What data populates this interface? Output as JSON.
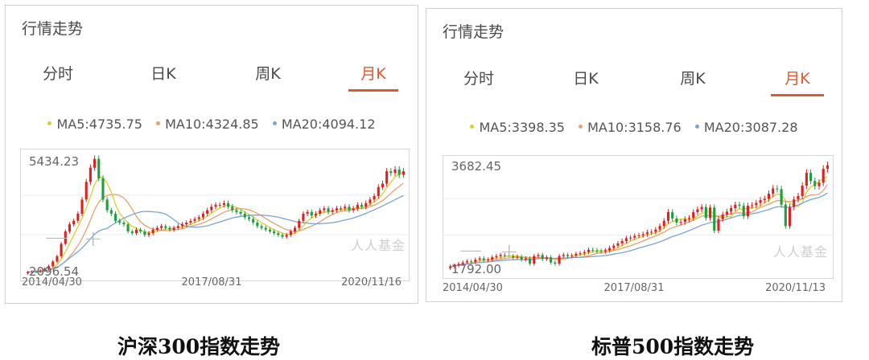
{
  "panels": [
    {
      "title": "行情走势",
      "tabs": [
        "分时",
        "日K",
        "周K",
        "月K"
      ],
      "active_tab": 3,
      "legend": [
        {
          "label": "MA5:4735.75",
          "color": "#d4d429"
        },
        {
          "label": "MA10:4324.85",
          "color": "#e8a070"
        },
        {
          "label": "MA20:4094.12",
          "color": "#7ba4d6"
        }
      ],
      "y_max_label": "5434.23",
      "y_min_label": "2096.54",
      "x_labels": [
        "2014/04/30",
        "2017/08/31",
        "2020/11/16"
      ],
      "watermark": "人人基金",
      "zoom_out": "—",
      "zoom_in": "+"
    },
    {
      "title": "行情走势",
      "tabs": [
        "分时",
        "日K",
        "周K",
        "月K"
      ],
      "active_tab": 3,
      "legend": [
        {
          "label": "MA5:3398.35",
          "color": "#d4d429"
        },
        {
          "label": "MA10:3158.76",
          "color": "#e8a070"
        },
        {
          "label": "MA20:3087.28",
          "color": "#7ba4d6"
        }
      ],
      "y_max_label": "3682.45",
      "y_min_label": "1792.00",
      "x_labels": [
        "2014/04/30",
        "2017/08/31",
        "2020/11/13"
      ],
      "watermark": "人人基金",
      "zoom_out": "—",
      "zoom_in": "+"
    }
  ],
  "captions": [
    "沪深300指数走势",
    "标普500指数走势"
  ],
  "chart_data": [
    {
      "type": "candlestick",
      "title": "沪深300指数走势",
      "ylim": [
        2096.54,
        5434.23
      ],
      "colors": {
        "up": "#e02020",
        "down": "#1f9e3f"
      },
      "x_start": "2014/04/30",
      "x_end": "2020/11/16",
      "close": [
        2150,
        2170,
        2160,
        2200,
        2240,
        2320,
        2450,
        2600,
        2950,
        3300,
        3500,
        3600,
        3800,
        4200,
        4700,
        5100,
        5350,
        4800,
        4200,
        3900,
        3800,
        3600,
        3550,
        3500,
        3300,
        3250,
        3350,
        3300,
        3200,
        3250,
        3350,
        3400,
        3450,
        3400,
        3350,
        3400,
        3450,
        3500,
        3550,
        3600,
        3650,
        3700,
        3800,
        3900,
        4000,
        4050,
        4050,
        4100,
        4000,
        3900,
        3850,
        3800,
        3700,
        3650,
        3550,
        3450,
        3400,
        3350,
        3300,
        3250,
        3200,
        3150,
        3200,
        3300,
        3400,
        3600,
        3800,
        3850,
        3750,
        3800,
        3900,
        3950,
        3850,
        3900,
        3950,
        3950,
        4000,
        3900,
        3950,
        4050,
        4000,
        4100,
        4200,
        4300,
        4550,
        4650,
        5000,
        4950,
        5050,
        4900,
        5000
      ]
    },
    {
      "type": "candlestick",
      "title": "标普500指数走势",
      "ylim": [
        1792.0,
        3682.45
      ],
      "colors": {
        "up": "#e02020",
        "down": "#1f9e3f"
      },
      "x_start": "2014/04/30",
      "x_end": "2020/11/13",
      "close": [
        1880,
        1900,
        1925,
        1950,
        1970,
        1960,
        2000,
        2020,
        1990,
        2000,
        2040,
        2060,
        2080,
        2070,
        2060,
        2040,
        2050,
        2000,
        2020,
        1930,
        2060,
        2080,
        2010,
        2040,
        1950,
        1930,
        2060,
        2080,
        2060,
        2070,
        2100,
        2110,
        2130,
        2170,
        2160,
        2150,
        2140,
        2160,
        2200,
        2240,
        2280,
        2320,
        2370,
        2380,
        2410,
        2420,
        2440,
        2470,
        2480,
        2520,
        2580,
        2670,
        2820,
        2710,
        2640,
        2650,
        2700,
        2720,
        2820,
        2870,
        2910,
        2720,
        2900,
        2500,
        2700,
        2780,
        2830,
        2890,
        2950,
        2930,
        2750,
        2930,
        2940,
        2980,
        3030,
        3050,
        3140,
        3230,
        3220,
        2950,
        2580,
        2910,
        3040,
        3100,
        3280,
        3500,
        3360,
        3270,
        3330,
        3570,
        3630
      ]
    }
  ]
}
